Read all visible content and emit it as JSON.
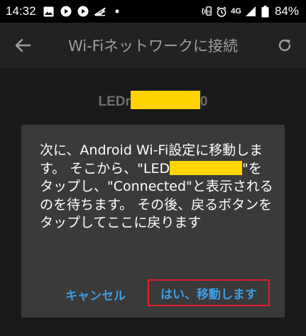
{
  "status_bar": {
    "time": "14:32",
    "network": "4G",
    "battery": "84%",
    "left_icons": [
      "image-icon",
      "youtube-icon",
      "youtube-icon",
      "arrow-send-icon",
      "dot-icon"
    ],
    "right_icons": [
      "nfc-icon",
      "alarm-icon",
      "signal-icon",
      "battery-icon"
    ]
  },
  "app_bar": {
    "title": "Wi-Fiネットワークに接続",
    "back_icon": "arrow-left-icon",
    "refresh_icon": "refresh-icon"
  },
  "background": {
    "device_prefix": "LEDr",
    "device_suffix": "0"
  },
  "dialog": {
    "msg_part1": "次に、Android Wi-Fi設定に移動します。 そこから、\"LED",
    "msg_part2": "\"をタップし、\"Connected\"と表示されるのを待ちます。 その後、戻るボタンをタップしてここに戻ります",
    "cancel_label": "キャンセル",
    "confirm_label": "はい、移動します"
  },
  "colors": {
    "accent": "#3d9ee6",
    "highlight_border": "#e0202a",
    "redaction": "#ffd400",
    "dialog_bg": "#3a3a3a",
    "app_bar_bg": "#222222"
  }
}
